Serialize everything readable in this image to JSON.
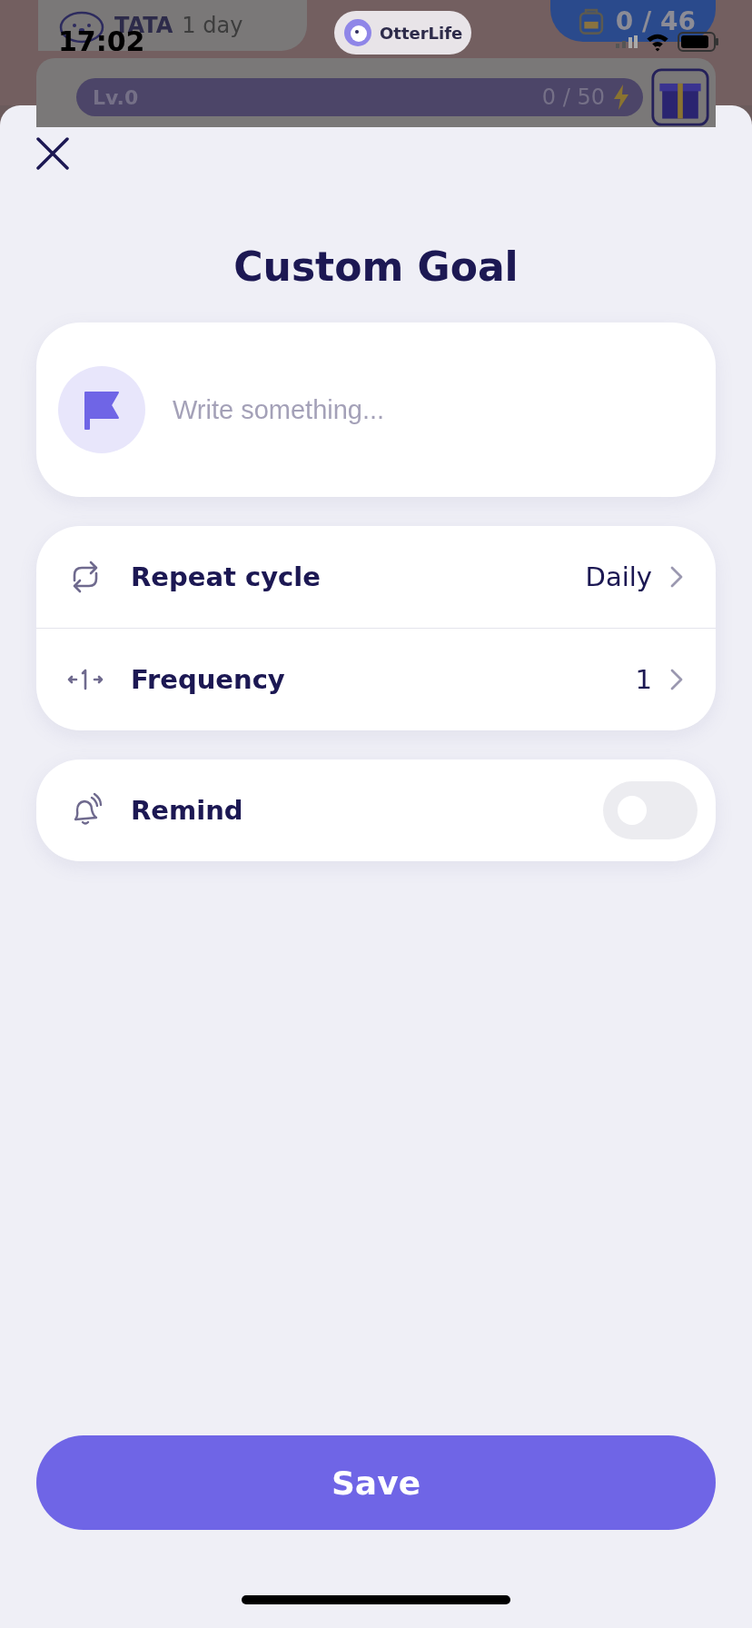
{
  "status_bar": {
    "time": "17:02"
  },
  "background_app": {
    "user": {
      "name": "TATA",
      "streak": "1 day"
    },
    "badge": {
      "label": "OtterLife"
    },
    "bag": {
      "count": "0 / 46"
    },
    "level": {
      "label": "Lv.0",
      "points": "0 / 50",
      "level": 0
    }
  },
  "sheet": {
    "title": "Custom Goal",
    "goal_input": {
      "placeholder": "Write something..."
    },
    "settings": [
      {
        "kind": "repeat",
        "label": "Repeat cycle",
        "value": "Daily"
      },
      {
        "kind": "frequency",
        "label": "Frequency",
        "value": "1"
      }
    ],
    "remind": {
      "label": "Remind",
      "on": false
    },
    "save_button": "Save"
  }
}
